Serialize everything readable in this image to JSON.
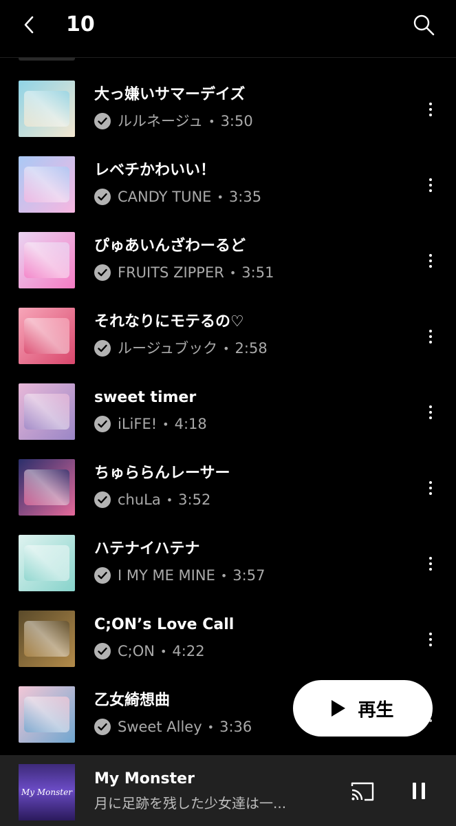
{
  "header": {
    "title": "10",
    "back_icon": "back-chevron-icon",
    "search_icon": "search-icon"
  },
  "tracks": [
    {
      "title": "大っ嫌いサマーデイズ",
      "artist": "ルルネージュ",
      "duration": "3:50",
      "colors": [
        "#8fd3e6",
        "#f3e7d0"
      ]
    },
    {
      "title": "レベチかわいい！",
      "artist": "CANDY TUNE",
      "duration": "3:35",
      "colors": [
        "#a9c9f5",
        "#f7b6e0"
      ]
    },
    {
      "title": "ぴゅあいんざわーるど",
      "artist": "FRUITS ZIPPER",
      "duration": "3:51",
      "colors": [
        "#e9d4f2",
        "#f57cc4"
      ]
    },
    {
      "title": "それなりにモテるの♡",
      "artist": "ルージュブック",
      "duration": "2:58",
      "colors": [
        "#f7a6b9",
        "#d9476c"
      ]
    },
    {
      "title": "sweet timer",
      "artist": "iLiFE!",
      "duration": "4:18",
      "colors": [
        "#e8b8d8",
        "#9a86c6"
      ]
    },
    {
      "title": "ちゅららんレーサー",
      "artist": "chuLa",
      "duration": "3:52",
      "colors": [
        "#2b2f6b",
        "#e56a9a"
      ]
    },
    {
      "title": "ハテナイハテナ",
      "artist": "I MY ME MINE",
      "duration": "3:57",
      "colors": [
        "#dff3f0",
        "#87d3cb"
      ]
    },
    {
      "title": "C;ON’s Love Call",
      "artist": "C;ON",
      "duration": "4:22",
      "colors": [
        "#5a4a2a",
        "#b38b4a"
      ]
    },
    {
      "title": "乙女綺想曲",
      "artist": "Sweet Alley",
      "duration": "3:36",
      "colors": [
        "#f3c7d6",
        "#6fa6cf"
      ]
    }
  ],
  "separator": "•",
  "play_button": {
    "label": "再生",
    "icon": "play-icon"
  },
  "now_playing": {
    "title": "My Monster",
    "subtitle": "月に足跡を残した少女達は一...",
    "thumb_text": "My Monster",
    "cast_icon": "cast-icon",
    "pause_icon": "pause-icon"
  },
  "colors": {
    "background": "#000000",
    "mini_player_bg": "#212121",
    "secondary_text": "#aaaaaa",
    "play_button_bg": "#ffffff"
  }
}
